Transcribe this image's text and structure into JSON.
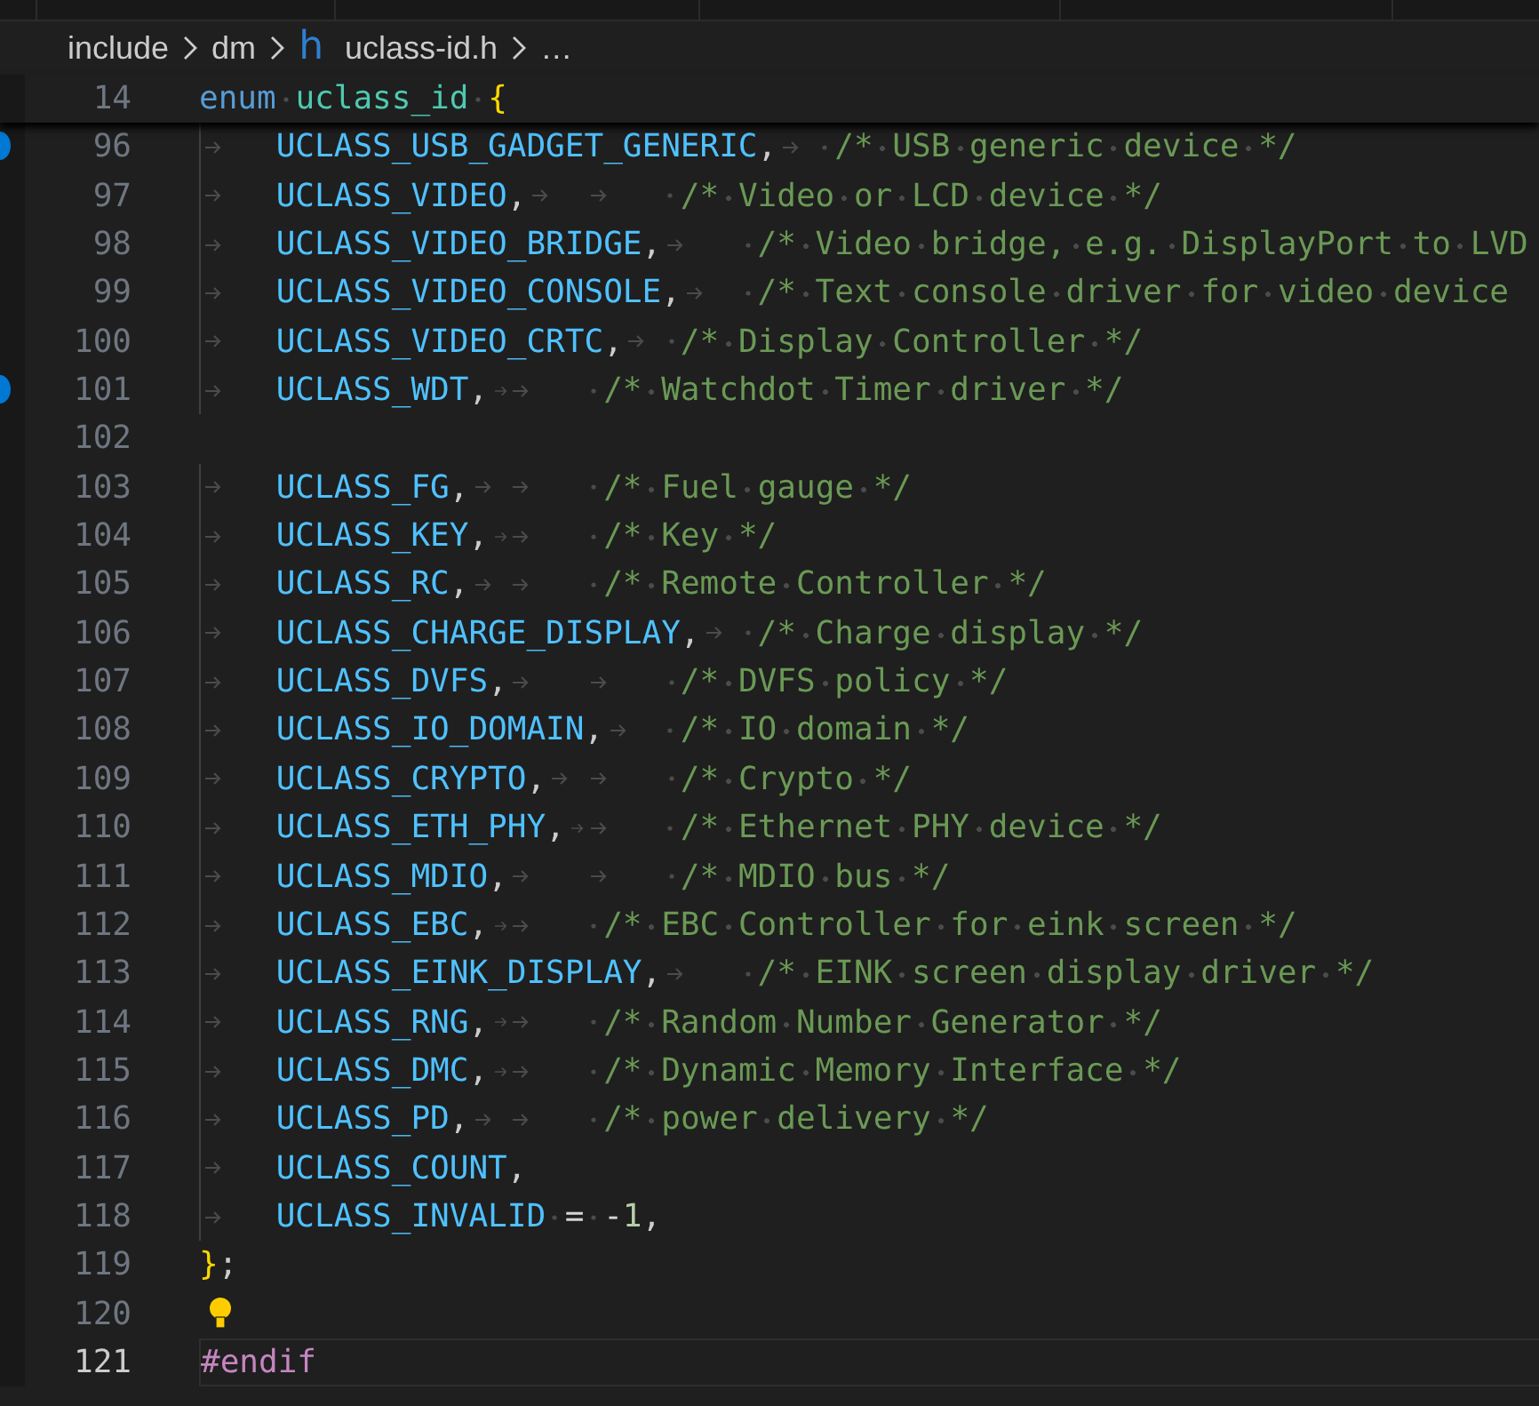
{
  "breadcrumb": [
    {
      "label": "include"
    },
    {
      "label": "dm"
    },
    {
      "icon": "h",
      "label": "uclass-id.h"
    },
    {
      "label": "…"
    }
  ],
  "sticky_line": {
    "number": "14",
    "tokens": [
      {
        "kind": "keyword",
        "text": "enum"
      },
      {
        "kind": "space"
      },
      {
        "kind": "type",
        "text": "uclass_id"
      },
      {
        "kind": "space"
      },
      {
        "kind": "brace",
        "text": "{"
      }
    ]
  },
  "lines": [
    {
      "number": "96",
      "marked": true,
      "tokens": [
        {
          "kind": "tab"
        },
        {
          "kind": "constant",
          "text": "UCLASS_USB_GADGET_GENERIC"
        },
        {
          "kind": "punct",
          "text": ","
        },
        {
          "kind": "tab"
        },
        {
          "kind": "space"
        },
        {
          "kind": "comment",
          "text": "/* USB generic device */"
        }
      ]
    },
    {
      "number": "97",
      "tokens": [
        {
          "kind": "tab"
        },
        {
          "kind": "constant",
          "text": "UCLASS_VIDEO"
        },
        {
          "kind": "punct",
          "text": ","
        },
        {
          "kind": "tab"
        },
        {
          "kind": "tab"
        },
        {
          "kind": "space"
        },
        {
          "kind": "comment",
          "text": "/* Video or LCD device */"
        }
      ]
    },
    {
      "number": "98",
      "tokens": [
        {
          "kind": "tab"
        },
        {
          "kind": "constant",
          "text": "UCLASS_VIDEO_BRIDGE"
        },
        {
          "kind": "punct",
          "text": ","
        },
        {
          "kind": "tab"
        },
        {
          "kind": "space"
        },
        {
          "kind": "comment",
          "text": "/* Video bridge, e.g. DisplayPort to LVD"
        }
      ]
    },
    {
      "number": "99",
      "tokens": [
        {
          "kind": "tab"
        },
        {
          "kind": "constant",
          "text": "UCLASS_VIDEO_CONSOLE"
        },
        {
          "kind": "punct",
          "text": ","
        },
        {
          "kind": "tab"
        },
        {
          "kind": "space"
        },
        {
          "kind": "comment",
          "text": "/* Text console driver for video device"
        }
      ]
    },
    {
      "number": "100",
      "tokens": [
        {
          "kind": "tab"
        },
        {
          "kind": "constant",
          "text": "UCLASS_VIDEO_CRTC"
        },
        {
          "kind": "punct",
          "text": ","
        },
        {
          "kind": "tab"
        },
        {
          "kind": "space"
        },
        {
          "kind": "comment",
          "text": "/* Display Controller */"
        }
      ]
    },
    {
      "number": "101",
      "marked": true,
      "tokens": [
        {
          "kind": "tab"
        },
        {
          "kind": "constant",
          "text": "UCLASS_WDT"
        },
        {
          "kind": "punct",
          "text": ","
        },
        {
          "kind": "tab"
        },
        {
          "kind": "tab"
        },
        {
          "kind": "space"
        },
        {
          "kind": "comment",
          "text": "/* Watchdot Timer driver */"
        }
      ]
    },
    {
      "number": "102"
    },
    {
      "number": "103",
      "tokens": [
        {
          "kind": "tab"
        },
        {
          "kind": "constant",
          "text": "UCLASS_FG"
        },
        {
          "kind": "punct",
          "text": ","
        },
        {
          "kind": "tab"
        },
        {
          "kind": "tab"
        },
        {
          "kind": "space"
        },
        {
          "kind": "comment",
          "text": "/* Fuel gauge */"
        }
      ]
    },
    {
      "number": "104",
      "tokens": [
        {
          "kind": "tab"
        },
        {
          "kind": "constant",
          "text": "UCLASS_KEY"
        },
        {
          "kind": "punct",
          "text": ","
        },
        {
          "kind": "tab"
        },
        {
          "kind": "tab"
        },
        {
          "kind": "space"
        },
        {
          "kind": "comment",
          "text": "/* Key */"
        }
      ]
    },
    {
      "number": "105",
      "tokens": [
        {
          "kind": "tab"
        },
        {
          "kind": "constant",
          "text": "UCLASS_RC"
        },
        {
          "kind": "punct",
          "text": ","
        },
        {
          "kind": "tab"
        },
        {
          "kind": "tab"
        },
        {
          "kind": "space"
        },
        {
          "kind": "comment",
          "text": "/* Remote Controller */"
        }
      ]
    },
    {
      "number": "106",
      "tokens": [
        {
          "kind": "tab"
        },
        {
          "kind": "constant",
          "text": "UCLASS_CHARGE_DISPLAY"
        },
        {
          "kind": "punct",
          "text": ","
        },
        {
          "kind": "tab"
        },
        {
          "kind": "space"
        },
        {
          "kind": "comment",
          "text": "/* Charge display */"
        }
      ]
    },
    {
      "number": "107",
      "tokens": [
        {
          "kind": "tab"
        },
        {
          "kind": "constant",
          "text": "UCLASS_DVFS"
        },
        {
          "kind": "punct",
          "text": ","
        },
        {
          "kind": "tab"
        },
        {
          "kind": "tab"
        },
        {
          "kind": "space"
        },
        {
          "kind": "comment",
          "text": "/* DVFS policy */"
        }
      ]
    },
    {
      "number": "108",
      "tokens": [
        {
          "kind": "tab"
        },
        {
          "kind": "constant",
          "text": "UCLASS_IO_DOMAIN"
        },
        {
          "kind": "punct",
          "text": ","
        },
        {
          "kind": "tab"
        },
        {
          "kind": "space"
        },
        {
          "kind": "comment",
          "text": "/* IO domain */"
        }
      ]
    },
    {
      "number": "109",
      "tokens": [
        {
          "kind": "tab"
        },
        {
          "kind": "constant",
          "text": "UCLASS_CRYPTO"
        },
        {
          "kind": "punct",
          "text": ","
        },
        {
          "kind": "tab"
        },
        {
          "kind": "tab"
        },
        {
          "kind": "space"
        },
        {
          "kind": "comment",
          "text": "/* Crypto */"
        }
      ]
    },
    {
      "number": "110",
      "tokens": [
        {
          "kind": "tab"
        },
        {
          "kind": "constant",
          "text": "UCLASS_ETH_PHY"
        },
        {
          "kind": "punct",
          "text": ","
        },
        {
          "kind": "tab"
        },
        {
          "kind": "tab"
        },
        {
          "kind": "space"
        },
        {
          "kind": "comment",
          "text": "/* Ethernet PHY device */"
        }
      ]
    },
    {
      "number": "111",
      "tokens": [
        {
          "kind": "tab"
        },
        {
          "kind": "constant",
          "text": "UCLASS_MDIO"
        },
        {
          "kind": "punct",
          "text": ","
        },
        {
          "kind": "tab"
        },
        {
          "kind": "tab"
        },
        {
          "kind": "space"
        },
        {
          "kind": "comment",
          "text": "/* MDIO bus */"
        }
      ]
    },
    {
      "number": "112",
      "tokens": [
        {
          "kind": "tab"
        },
        {
          "kind": "constant",
          "text": "UCLASS_EBC"
        },
        {
          "kind": "punct",
          "text": ","
        },
        {
          "kind": "tab"
        },
        {
          "kind": "tab"
        },
        {
          "kind": "space"
        },
        {
          "kind": "comment",
          "text": "/* EBC Controller for eink screen */"
        }
      ]
    },
    {
      "number": "113",
      "tokens": [
        {
          "kind": "tab"
        },
        {
          "kind": "constant",
          "text": "UCLASS_EINK_DISPLAY"
        },
        {
          "kind": "punct",
          "text": ","
        },
        {
          "kind": "tab"
        },
        {
          "kind": "space"
        },
        {
          "kind": "comment",
          "text": "/* EINK screen display driver */"
        }
      ]
    },
    {
      "number": "114",
      "tokens": [
        {
          "kind": "tab"
        },
        {
          "kind": "constant",
          "text": "UCLASS_RNG"
        },
        {
          "kind": "punct",
          "text": ","
        },
        {
          "kind": "tab"
        },
        {
          "kind": "tab"
        },
        {
          "kind": "space"
        },
        {
          "kind": "comment",
          "text": "/* Random Number Generator */"
        }
      ]
    },
    {
      "number": "115",
      "tokens": [
        {
          "kind": "tab"
        },
        {
          "kind": "constant",
          "text": "UCLASS_DMC"
        },
        {
          "kind": "punct",
          "text": ","
        },
        {
          "kind": "tab"
        },
        {
          "kind": "tab"
        },
        {
          "kind": "space"
        },
        {
          "kind": "comment",
          "text": "/* Dynamic Memory Interface */"
        }
      ]
    },
    {
      "number": "116",
      "tokens": [
        {
          "kind": "tab"
        },
        {
          "kind": "constant",
          "text": "UCLASS_PD"
        },
        {
          "kind": "punct",
          "text": ","
        },
        {
          "kind": "tab"
        },
        {
          "kind": "tab"
        },
        {
          "kind": "space"
        },
        {
          "kind": "comment",
          "text": "/* power delivery */"
        }
      ]
    },
    {
      "number": "117",
      "tokens": [
        {
          "kind": "tab"
        },
        {
          "kind": "constant",
          "text": "UCLASS_COUNT"
        },
        {
          "kind": "punct",
          "text": ","
        }
      ]
    },
    {
      "number": "118",
      "tokens": [
        {
          "kind": "tab"
        },
        {
          "kind": "constant",
          "text": "UCLASS_INVALID"
        },
        {
          "kind": "space"
        },
        {
          "kind": "operator",
          "text": "="
        },
        {
          "kind": "space"
        },
        {
          "kind": "operator",
          "text": "-"
        },
        {
          "kind": "number",
          "text": "1"
        },
        {
          "kind": "punct",
          "text": ","
        }
      ]
    },
    {
      "number": "119",
      "tokens": [
        {
          "kind": "brace",
          "text": "}"
        },
        {
          "kind": "punct",
          "text": ";"
        }
      ]
    },
    {
      "number": "120",
      "lightbulb": true
    },
    {
      "number": "121",
      "current": true,
      "tokens": [
        {
          "kind": "preproc",
          "text": "#endif"
        }
      ]
    }
  ]
}
